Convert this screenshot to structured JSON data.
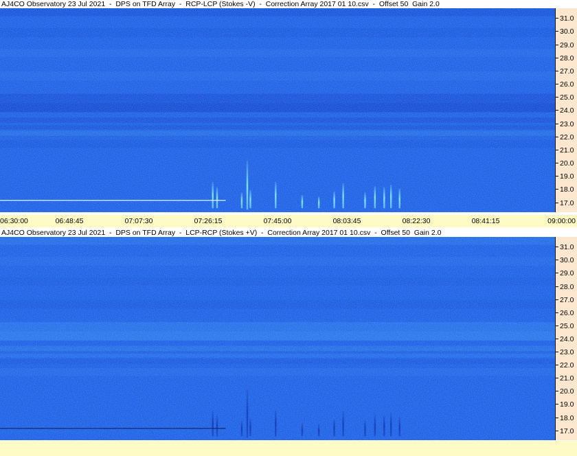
{
  "colors": {
    "background": "#ffffff",
    "axis_bg": "#fde8cf",
    "time_bar_bg": "#fffbc6",
    "spectrum_base": "#1f63e6",
    "band_dark": "#1444c8",
    "band_light": "#3a8ef0",
    "burst_top": "#8ff7ff",
    "burst_bottom": "#1238b0",
    "injection_line_top": "#d7f5ff",
    "injection_line_bottom": "#1a2a70"
  },
  "chart_data": [
    {
      "type": "heatmap",
      "title": "AJ4CO Observatory 23 Jul 2021  -  DPS on TFD Array  -  RCP-LCP (Stokes -V)  -  Correction Array 2017 01 10.csv  -  Offset 50  Gain 2.0",
      "xlabel": "",
      "ylabel": "",
      "x_ticks": [
        "06:30:00",
        "06:48:45",
        "07:07:30",
        "07:26:15",
        "07:45:00",
        "08:03:45",
        "08:22:30",
        "08:41:15",
        "09:00:00"
      ],
      "y_ticks": [
        "31.0",
        "30.0",
        "29.0",
        "28.0",
        "27.0",
        "26.0",
        "25.0",
        "24.0",
        "23.0",
        "22.0",
        "21.0",
        "20.0",
        "19.0",
        "18.0",
        "17.0"
      ],
      "xlim": [
        "06:30:00",
        "09:00:00"
      ],
      "ylim": [
        16.3,
        31.8
      ],
      "bands": [
        {
          "y0": 31.8,
          "y1": 31.2,
          "tone": "dark",
          "strength": 0.35
        },
        {
          "y0": 30.3,
          "y1": 29.6,
          "tone": "dark",
          "strength": 0.2
        },
        {
          "y0": 28.7,
          "y1": 28.1,
          "tone": "light",
          "strength": 0.15
        },
        {
          "y0": 27.0,
          "y1": 26.3,
          "tone": "light",
          "strength": 0.15
        },
        {
          "y0": 25.3,
          "y1": 24.6,
          "tone": "dark",
          "strength": 0.4
        },
        {
          "y0": 24.6,
          "y1": 23.9,
          "tone": "dark",
          "strength": 0.6
        },
        {
          "y0": 23.5,
          "y1": 23.1,
          "tone": "dark",
          "strength": 0.35
        },
        {
          "y0": 22.9,
          "y1": 22.6,
          "tone": "dark",
          "strength": 0.3
        },
        {
          "y0": 22.5,
          "y1": 22.1,
          "tone": "light",
          "strength": 0.25
        },
        {
          "y0": 21.8,
          "y1": 21.2,
          "tone": "dark",
          "strength": 0.2
        }
      ],
      "bursts": [
        {
          "time": "07:27:30",
          "f_low": 16.6,
          "f_high": 18.6
        },
        {
          "time": "07:28:40",
          "f_low": 16.6,
          "f_high": 18.2
        },
        {
          "time": "07:35:20",
          "f_low": 16.6,
          "f_high": 17.8
        },
        {
          "time": "07:36:50",
          "f_low": 16.5,
          "f_high": 20.2
        },
        {
          "time": "07:37:40",
          "f_low": 16.6,
          "f_high": 18.0
        },
        {
          "time": "07:44:30",
          "f_low": 16.6,
          "f_high": 18.6
        },
        {
          "time": "07:51:40",
          "f_low": 16.6,
          "f_high": 17.6
        },
        {
          "time": "07:56:10",
          "f_low": 16.6,
          "f_high": 17.5
        },
        {
          "time": "08:00:20",
          "f_low": 16.6,
          "f_high": 17.9
        },
        {
          "time": "08:02:45",
          "f_low": 16.6,
          "f_high": 18.5
        },
        {
          "time": "08:08:40",
          "f_low": 16.6,
          "f_high": 17.8
        },
        {
          "time": "08:11:20",
          "f_low": 16.6,
          "f_high": 18.3
        },
        {
          "time": "08:13:50",
          "f_low": 16.6,
          "f_high": 18.2
        },
        {
          "time": "08:15:40",
          "f_low": 16.6,
          "f_high": 18.4
        },
        {
          "time": "08:18:00",
          "f_low": 16.6,
          "f_high": 18.1
        }
      ],
      "injection_line": {
        "freq": 17.2,
        "start": "06:30:00",
        "end": "07:31:00"
      },
      "polarity": "bright"
    },
    {
      "type": "heatmap",
      "title": "AJ4CO Observatory 23 Jul 2021  -  DPS on TFD Array  -  LCP-RCP (Stokes +V)  -  Correction Array 2017 01 10.csv  -  Offset 50  Gain 2.0",
      "xlabel": "",
      "ylabel": "",
      "x_ticks": [],
      "y_ticks": [
        "31.0",
        "30.0",
        "29.0",
        "28.0",
        "27.0",
        "26.0",
        "25.0",
        "24.0",
        "23.0",
        "22.0",
        "21.0",
        "20.0",
        "19.0",
        "18.0",
        "17.0"
      ],
      "xlim": [
        "06:30:00",
        "09:00:00"
      ],
      "ylim": [
        16.3,
        31.8
      ],
      "bands": [
        {
          "y0": 31.8,
          "y1": 31.2,
          "tone": "light",
          "strength": 0.25
        },
        {
          "y0": 30.3,
          "y1": 29.6,
          "tone": "light",
          "strength": 0.15
        },
        {
          "y0": 28.7,
          "y1": 28.1,
          "tone": "dark",
          "strength": 0.1
        },
        {
          "y0": 27.0,
          "y1": 26.3,
          "tone": "dark",
          "strength": 0.15
        },
        {
          "y0": 25.3,
          "y1": 24.6,
          "tone": "light",
          "strength": 0.35
        },
        {
          "y0": 24.6,
          "y1": 23.9,
          "tone": "light",
          "strength": 0.5
        },
        {
          "y0": 23.5,
          "y1": 23.1,
          "tone": "light",
          "strength": 0.3
        },
        {
          "y0": 22.9,
          "y1": 22.6,
          "tone": "light",
          "strength": 0.25
        },
        {
          "y0": 22.5,
          "y1": 22.1,
          "tone": "dark",
          "strength": 0.2
        },
        {
          "y0": 21.8,
          "y1": 21.2,
          "tone": "light",
          "strength": 0.15
        }
      ],
      "bursts": [
        {
          "time": "07:27:30",
          "f_low": 16.6,
          "f_high": 18.6
        },
        {
          "time": "07:28:40",
          "f_low": 16.6,
          "f_high": 18.2
        },
        {
          "time": "07:35:20",
          "f_low": 16.6,
          "f_high": 17.8
        },
        {
          "time": "07:36:50",
          "f_low": 16.5,
          "f_high": 20.2
        },
        {
          "time": "07:37:40",
          "f_low": 16.6,
          "f_high": 18.0
        },
        {
          "time": "07:44:30",
          "f_low": 16.6,
          "f_high": 18.6
        },
        {
          "time": "07:51:40",
          "f_low": 16.6,
          "f_high": 17.6
        },
        {
          "time": "07:56:10",
          "f_low": 16.6,
          "f_high": 17.5
        },
        {
          "time": "08:00:20",
          "f_low": 16.6,
          "f_high": 17.9
        },
        {
          "time": "08:02:45",
          "f_low": 16.6,
          "f_high": 18.5
        },
        {
          "time": "08:08:40",
          "f_low": 16.6,
          "f_high": 17.8
        },
        {
          "time": "08:11:20",
          "f_low": 16.6,
          "f_high": 18.3
        },
        {
          "time": "08:13:50",
          "f_low": 16.6,
          "f_high": 18.2
        },
        {
          "time": "08:15:40",
          "f_low": 16.6,
          "f_high": 18.4
        },
        {
          "time": "08:18:00",
          "f_low": 16.6,
          "f_high": 18.1
        }
      ],
      "injection_line": {
        "freq": 17.2,
        "start": "06:30:00",
        "end": "07:31:00"
      },
      "polarity": "dark"
    }
  ]
}
